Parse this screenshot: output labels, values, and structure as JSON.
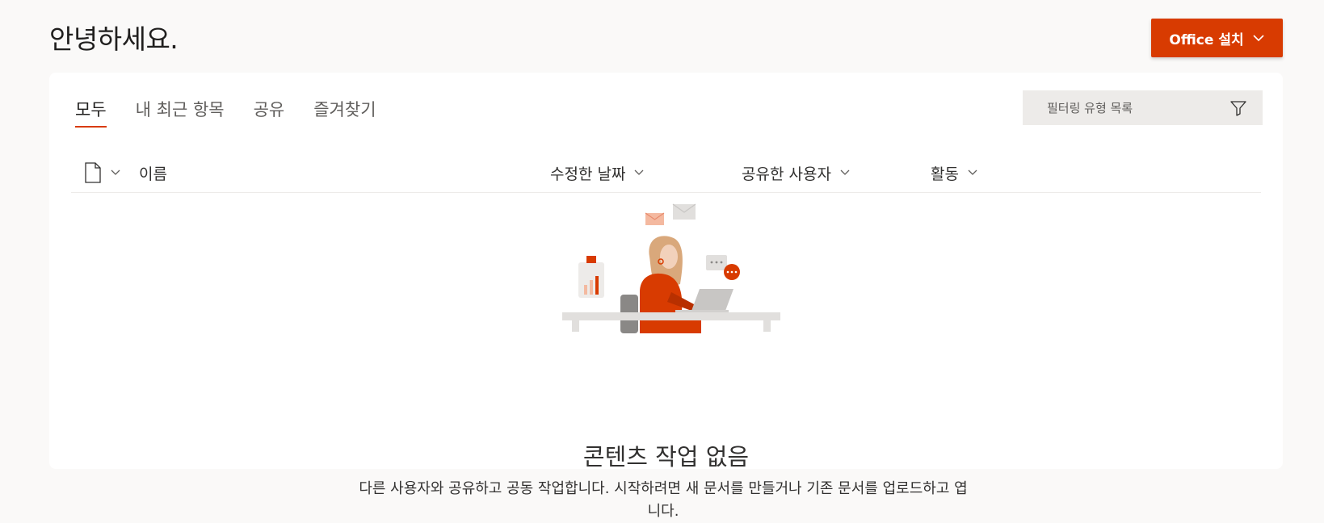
{
  "header": {
    "greeting": "안녕하세요.",
    "install_button_label": "Office 설치"
  },
  "tabs": [
    {
      "label": "모두",
      "active": true
    },
    {
      "label": "내 최근 항목",
      "active": false
    },
    {
      "label": "공유",
      "active": false
    },
    {
      "label": "즐겨찾기",
      "active": false
    }
  ],
  "filter": {
    "placeholder": "필터링 유형 목록"
  },
  "columns": {
    "name": "이름",
    "modified": "수정한 날짜",
    "shared_by": "공유한 사용자",
    "activity": "활동"
  },
  "empty_state": {
    "title": "콘텐츠 작업 없음",
    "description": "다른 사용자와 공유하고 공동 작업합니다. 시작하려면 새 문서를 만들거나 기존 문서를 업로드하고 엽니다."
  },
  "colors": {
    "accent": "#d83b01",
    "background": "#faf9f8",
    "card": "#ffffff"
  },
  "icons": {
    "install_chevron": "chevron-down-icon",
    "filter": "filter-icon",
    "file_type": "document-icon"
  }
}
